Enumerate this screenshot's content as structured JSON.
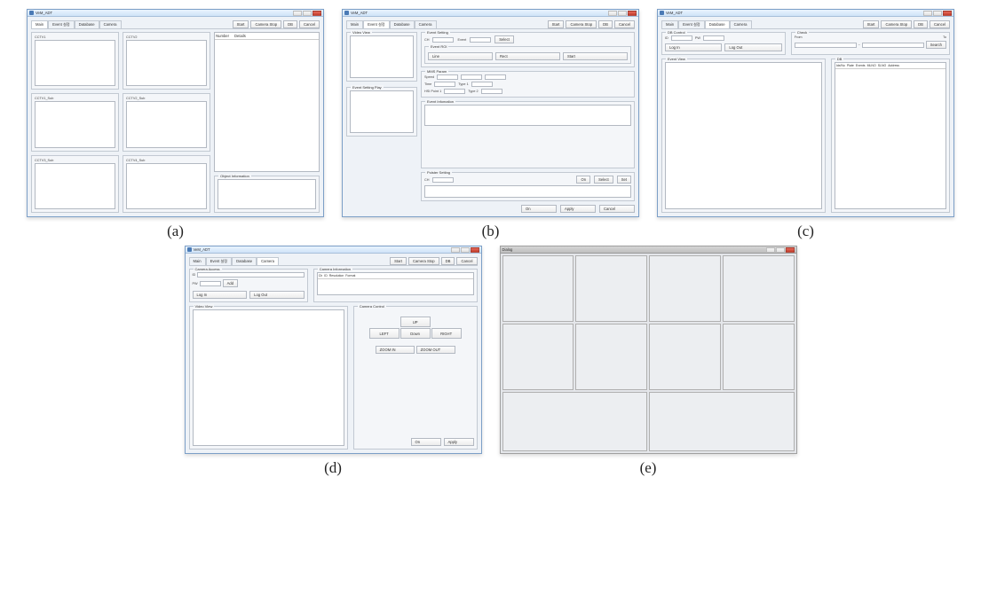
{
  "captions": {
    "a": "(a)",
    "b": "(b)",
    "c": "(c)",
    "d": "(d)",
    "e": "(e)"
  },
  "app_title": "VeM_ADT",
  "tabs": {
    "main": "Main",
    "event": "Event 설정",
    "database": "Database",
    "camera": "Camera"
  },
  "top_buttons": {
    "start": "Start",
    "camera_stop": "Camera Stop",
    "db": "DB",
    "cancel": "Cancel"
  },
  "a": {
    "grid_labels": {
      "cctv1": "CCTV1",
      "cctv2": "CCTV2",
      "cctv1_sub": "CCTV1_Sub",
      "cctv2_sub": "CCTV2_Sub",
      "cctv3_sub": "CCTV3_Sub",
      "cctv4_sub": "CCTV4_Sub"
    },
    "list_headers": {
      "number": "Number",
      "details": "Details"
    },
    "object_info": "Object Information"
  },
  "b": {
    "video_view": "Video View",
    "event_setting_play": "Event Setting Play",
    "event_setting": "Event Setting",
    "ch": "CH",
    "event_label": "Event",
    "select_btn": "Select",
    "event_roi": "Event ROI",
    "roi_buttons": {
      "line": "Line",
      "rect": "Rect",
      "start": "Start"
    },
    "mms_param": "MMS Param",
    "speed": "Speed",
    "time": "Time",
    "type1": "Type 1",
    "type2": "Type 2",
    "hsi_point": "HSI Point 1",
    "event_infomation": "Event Infomation",
    "polster_setting": "Polster Setting",
    "poi_ch": "CH",
    "polster_buttons": {
      "on": "On",
      "select": "Select",
      "set": "Set"
    },
    "bottom_buttons": {
      "on": "On",
      "apply": "Apply",
      "cancel": "Cancel"
    }
  },
  "c": {
    "db_control": "DB Control",
    "id": "ID",
    "pw": "PW",
    "login": "Log In",
    "logout": "Log Out",
    "check": "Check",
    "from": "From",
    "to": "To",
    "search": "Search",
    "event_view": "Event View",
    "db": "DB",
    "db_cols": {
      "idx": "Idx/No",
      "plate": "Plate",
      "events": "Events",
      "mlno": "MLNO",
      "slno": "SLNO",
      "address": "Address"
    }
  },
  "d": {
    "camera_access": "Camera Access",
    "id": "ID",
    "pw": "PW",
    "add": "Add",
    "login": "Log In",
    "logout": "Log Out",
    "camera_information": "Camera Information",
    "info_cols": {
      "ch": "Ch",
      "id": "ID",
      "resolution": "Resolution",
      "format": "Format"
    },
    "video_view": "Video View",
    "camera_control": "Camera Control",
    "ptz": {
      "up": "UP",
      "left": "LEFT",
      "right": "RIGHT",
      "down": "Down"
    },
    "zoom_in": "ZOOM IN",
    "zoom_out": "ZOOM OUT",
    "bottom_buttons": {
      "on": "On",
      "apply": "Apply"
    }
  },
  "e": {
    "dialog_title": "Dialog"
  }
}
